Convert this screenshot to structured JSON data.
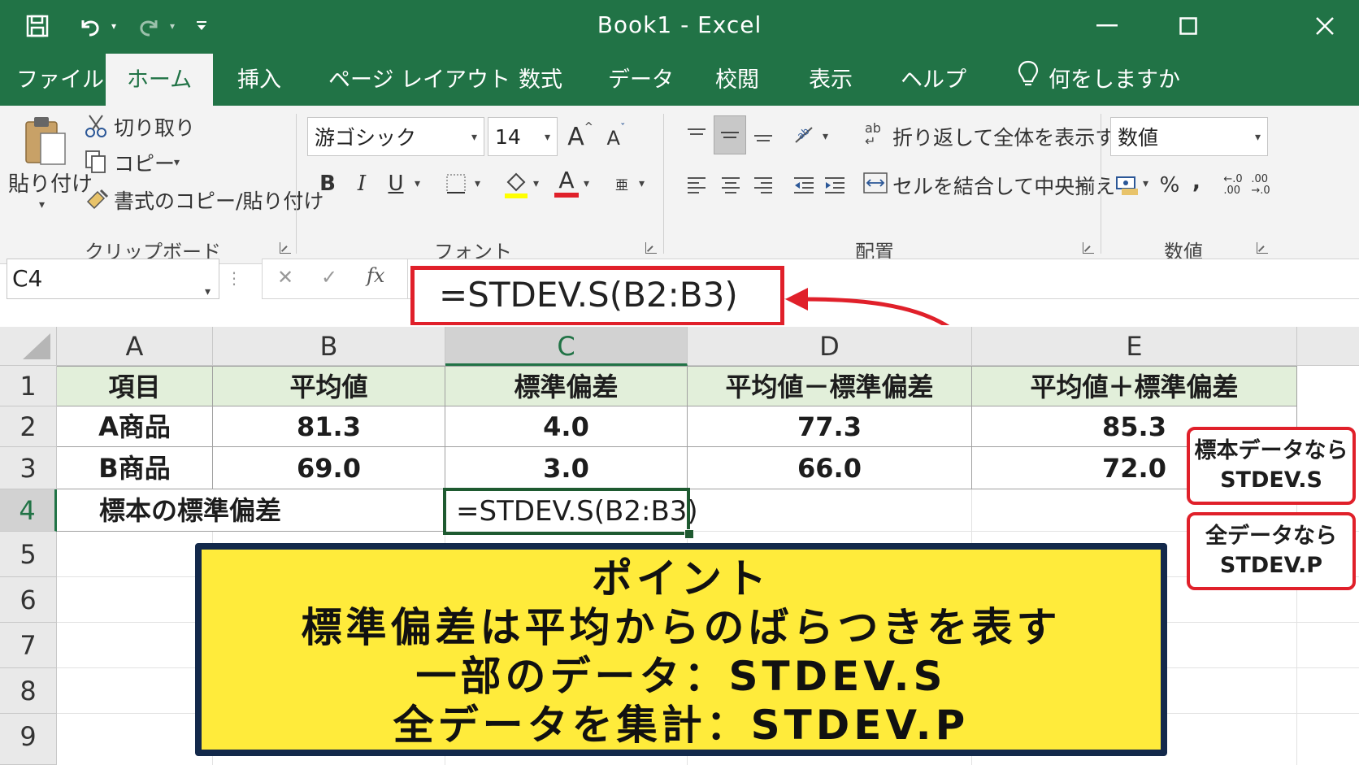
{
  "titlebar": {
    "title": "Book1 - Excel",
    "icons": [
      "save-icon",
      "undo-icon",
      "redo-icon",
      "customize-qat-icon",
      "minimize-icon",
      "maximize-icon",
      "close-icon"
    ]
  },
  "tabs": [
    "ファイル",
    "ホーム",
    "挿入",
    "ページ レイアウト",
    "数式",
    "データ",
    "校閲",
    "表示",
    "ヘルプ"
  ],
  "tell_me": "何をしますか",
  "ribbon": {
    "clipboard": {
      "paste": "貼り付け",
      "cut": "切り取り",
      "copy": "コピー",
      "format_painter": "書式のコピー/貼り付け",
      "label": "クリップボード"
    },
    "font": {
      "font_name": "游ゴシック",
      "font_size": "14",
      "grow": "A",
      "shrink": "A",
      "bold": "B",
      "italic": "I",
      "underline": "U",
      "font_color": "A",
      "label": "フォント"
    },
    "alignment": {
      "wrap_text": "折り返して全体を表示する",
      "merge_center": "セルを結合して中央揃え",
      "label": "配置"
    },
    "number": {
      "format": "数値",
      "percent": "%",
      "comma": ",",
      "label": "数値"
    }
  },
  "formula_bar": {
    "name_box": "C4",
    "cancel": "✕",
    "enter": "✓",
    "fx": "fx",
    "formula": "=STDEV.S(B2:B3)"
  },
  "grid": {
    "columns": [
      "A",
      "B",
      "C",
      "D",
      "E"
    ],
    "rows": [
      "1",
      "2",
      "3",
      "4",
      "5",
      "6",
      "7",
      "8",
      "9"
    ],
    "header_row": [
      "項目",
      "平均値",
      "標準偏差",
      "平均値－標準偏差",
      "平均値＋標準偏差"
    ],
    "data": [
      [
        "A商品",
        "81.3",
        "4.0",
        "77.3",
        "85.3"
      ],
      [
        "B商品",
        "69.0",
        "3.0",
        "66.0",
        "72.0"
      ]
    ],
    "row4_label": "標本の標準偏差",
    "active_cell_text": "=STDEV.S(B2:B3)"
  },
  "callouts": {
    "sample": [
      "標本データなら",
      "STDEV.S"
    ],
    "population": [
      "全データなら",
      "STDEV.P"
    ]
  },
  "point_box": {
    "lines": [
      "ポイント",
      "標準偏差は平均からのばらつきを表す",
      "一部のデータ：STDEV.S",
      "全データを集計：STDEV.P"
    ]
  },
  "colors": {
    "excel_green": "#217346",
    "header_fill": "#e2efda",
    "highlight_red": "#e0202a",
    "point_yellow": "#ffeb3b",
    "point_border": "#13294b"
  }
}
